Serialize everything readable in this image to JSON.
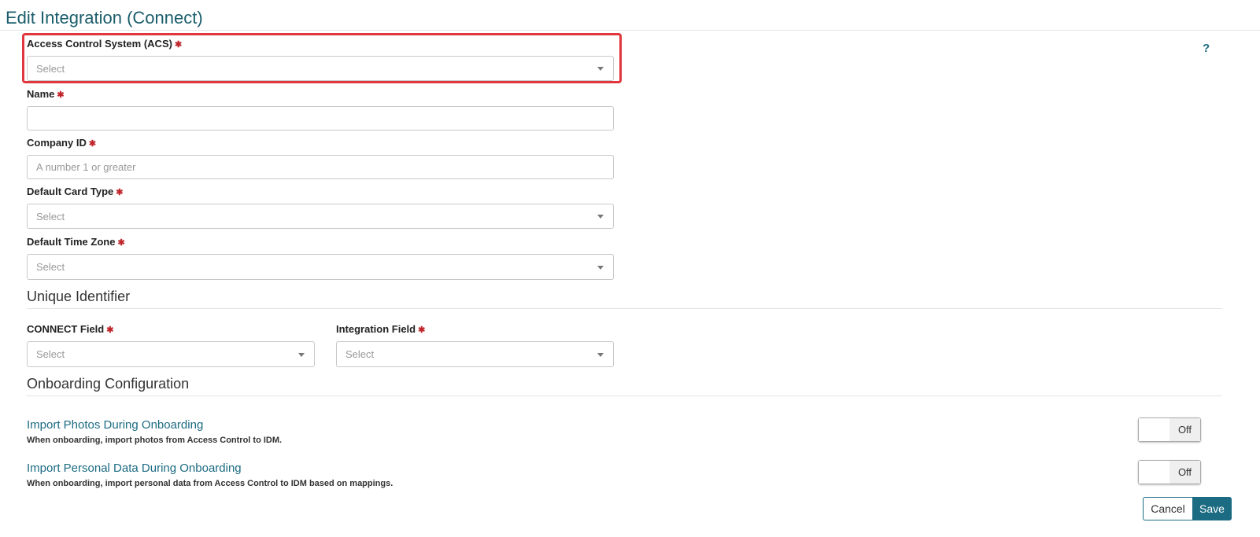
{
  "page": {
    "title": "Edit Integration (Connect)",
    "help": "?"
  },
  "colors": {
    "accent": "#1b6b82",
    "required": "#c0272d",
    "highlight": "#e0373f"
  },
  "form": {
    "required_mark": "✱",
    "acs": {
      "label": "Access Control System (ACS)",
      "placeholder": "Select"
    },
    "name": {
      "label": "Name",
      "value": ""
    },
    "company_id": {
      "label": "Company ID",
      "placeholder": "A number 1 or greater"
    },
    "card_type": {
      "label": "Default Card Type",
      "placeholder": "Select"
    },
    "time_zone": {
      "label": "Default Time Zone",
      "placeholder": "Select"
    }
  },
  "unique_identifier": {
    "title": "Unique Identifier",
    "connect_field": {
      "label": "CONNECT Field",
      "placeholder": "Select"
    },
    "integration_field": {
      "label": "Integration Field",
      "placeholder": "Select"
    }
  },
  "onboarding": {
    "title": "Onboarding Configuration",
    "items": [
      {
        "title": "Import Photos During Onboarding",
        "description": "When onboarding, import photos from Access Control to IDM.",
        "state": "Off"
      },
      {
        "title": "Import Personal Data During Onboarding",
        "description": "When onboarding, import personal data from Access Control to IDM based on mappings.",
        "state": "Off"
      }
    ]
  },
  "actions": {
    "cancel": "Cancel",
    "save": "Save"
  }
}
